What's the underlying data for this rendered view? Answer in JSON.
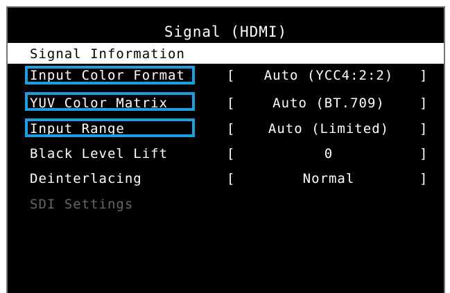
{
  "title": "Signal (HDMI)",
  "menu": [
    {
      "label": "Signal Information",
      "value": null,
      "state": "selected"
    },
    {
      "label": "Input Color Format",
      "value": "Auto (YCC4:2:2)",
      "state": "normal"
    },
    {
      "label": "YUV Color Matrix",
      "value": "Auto (BT.709)",
      "state": "normal"
    },
    {
      "label": "Input Range",
      "value": "Auto (Limited)",
      "state": "normal"
    },
    {
      "label": "Black Level Lift",
      "value": "0",
      "state": "normal"
    },
    {
      "label": "Deinterlacing",
      "value": "Normal",
      "state": "normal"
    },
    {
      "label": "SDI Settings",
      "value": null,
      "state": "disabled"
    }
  ],
  "brackets": {
    "open": "[",
    "close": "]"
  },
  "colors": {
    "osd_background": "#000000",
    "text": "#ffffff",
    "selected_background": "#ffffff",
    "disabled_text": "#666666",
    "highlight_box": "#1b9fe0"
  }
}
